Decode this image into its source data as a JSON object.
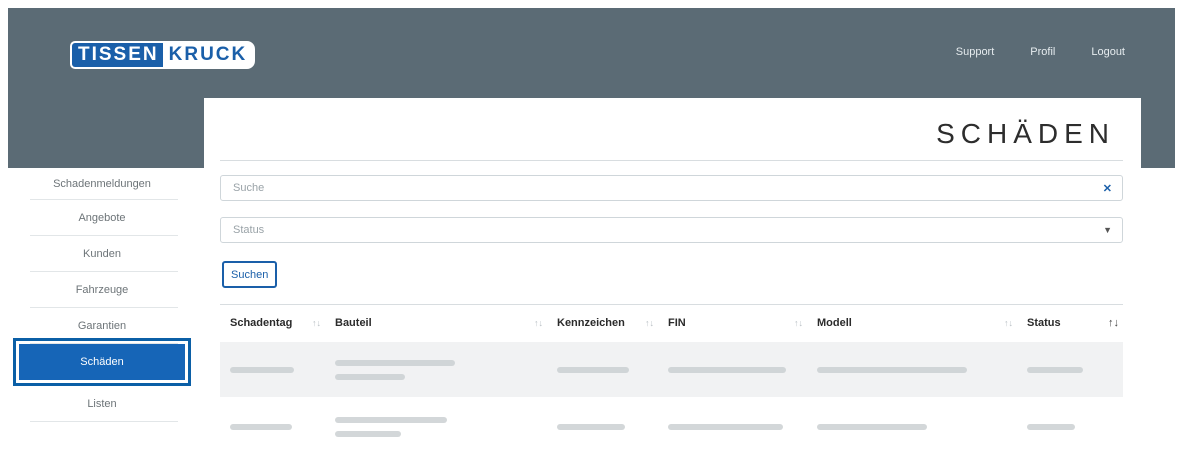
{
  "brand": {
    "logo_part1": "TISSEN",
    "logo_part2": "KRUCK"
  },
  "topnav": {
    "support": "Support",
    "profile": "Profil",
    "logout": "Logout"
  },
  "page": {
    "title": "SCHÄDEN"
  },
  "filters": {
    "search_placeholder": "Suche",
    "status_placeholder": "Status",
    "search_button": "Suchen"
  },
  "table": {
    "columns": [
      "Schadentag",
      "Bauteil",
      "Kennzeichen",
      "FIN",
      "Modell",
      "Status"
    ]
  },
  "sidebar": {
    "items": [
      {
        "label": "Schadenmeldungen"
      },
      {
        "label": "Angebote"
      },
      {
        "label": "Kunden"
      },
      {
        "label": "Fahrzeuge"
      },
      {
        "label": "Garantien"
      },
      {
        "label": "Schäden"
      },
      {
        "label": "Listen"
      }
    ]
  },
  "colors": {
    "header": "#5b6b75",
    "accent": "#1665b7"
  }
}
